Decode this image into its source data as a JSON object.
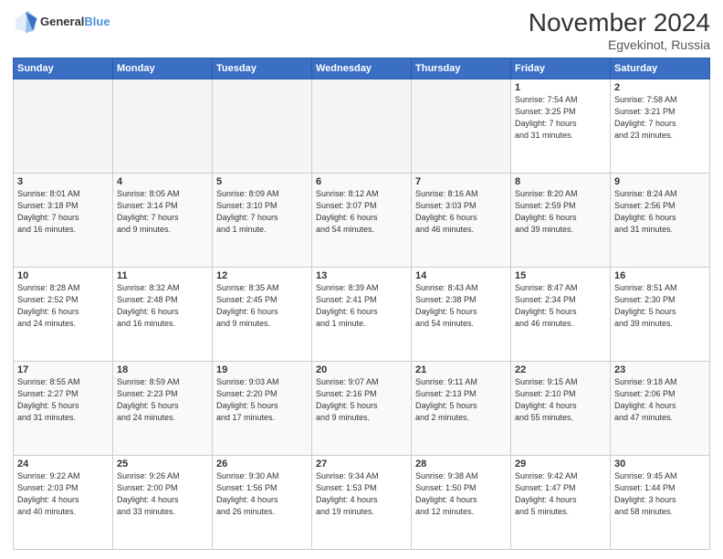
{
  "header": {
    "logo_line1": "General",
    "logo_line2": "Blue",
    "title": "November 2024",
    "subtitle": "Egvekinot, Russia"
  },
  "days_of_week": [
    "Sunday",
    "Monday",
    "Tuesday",
    "Wednesday",
    "Thursday",
    "Friday",
    "Saturday"
  ],
  "weeks": [
    [
      {
        "day": "",
        "info": ""
      },
      {
        "day": "",
        "info": ""
      },
      {
        "day": "",
        "info": ""
      },
      {
        "day": "",
        "info": ""
      },
      {
        "day": "",
        "info": ""
      },
      {
        "day": "1",
        "info": "Sunrise: 7:54 AM\nSunset: 3:25 PM\nDaylight: 7 hours\nand 31 minutes."
      },
      {
        "day": "2",
        "info": "Sunrise: 7:58 AM\nSunset: 3:21 PM\nDaylight: 7 hours\nand 23 minutes."
      }
    ],
    [
      {
        "day": "3",
        "info": "Sunrise: 8:01 AM\nSunset: 3:18 PM\nDaylight: 7 hours\nand 16 minutes."
      },
      {
        "day": "4",
        "info": "Sunrise: 8:05 AM\nSunset: 3:14 PM\nDaylight: 7 hours\nand 9 minutes."
      },
      {
        "day": "5",
        "info": "Sunrise: 8:09 AM\nSunset: 3:10 PM\nDaylight: 7 hours\nand 1 minute."
      },
      {
        "day": "6",
        "info": "Sunrise: 8:12 AM\nSunset: 3:07 PM\nDaylight: 6 hours\nand 54 minutes."
      },
      {
        "day": "7",
        "info": "Sunrise: 8:16 AM\nSunset: 3:03 PM\nDaylight: 6 hours\nand 46 minutes."
      },
      {
        "day": "8",
        "info": "Sunrise: 8:20 AM\nSunset: 2:59 PM\nDaylight: 6 hours\nand 39 minutes."
      },
      {
        "day": "9",
        "info": "Sunrise: 8:24 AM\nSunset: 2:56 PM\nDaylight: 6 hours\nand 31 minutes."
      }
    ],
    [
      {
        "day": "10",
        "info": "Sunrise: 8:28 AM\nSunset: 2:52 PM\nDaylight: 6 hours\nand 24 minutes."
      },
      {
        "day": "11",
        "info": "Sunrise: 8:32 AM\nSunset: 2:48 PM\nDaylight: 6 hours\nand 16 minutes."
      },
      {
        "day": "12",
        "info": "Sunrise: 8:35 AM\nSunset: 2:45 PM\nDaylight: 6 hours\nand 9 minutes."
      },
      {
        "day": "13",
        "info": "Sunrise: 8:39 AM\nSunset: 2:41 PM\nDaylight: 6 hours\nand 1 minute."
      },
      {
        "day": "14",
        "info": "Sunrise: 8:43 AM\nSunset: 2:38 PM\nDaylight: 5 hours\nand 54 minutes."
      },
      {
        "day": "15",
        "info": "Sunrise: 8:47 AM\nSunset: 2:34 PM\nDaylight: 5 hours\nand 46 minutes."
      },
      {
        "day": "16",
        "info": "Sunrise: 8:51 AM\nSunset: 2:30 PM\nDaylight: 5 hours\nand 39 minutes."
      }
    ],
    [
      {
        "day": "17",
        "info": "Sunrise: 8:55 AM\nSunset: 2:27 PM\nDaylight: 5 hours\nand 31 minutes."
      },
      {
        "day": "18",
        "info": "Sunrise: 8:59 AM\nSunset: 2:23 PM\nDaylight: 5 hours\nand 24 minutes."
      },
      {
        "day": "19",
        "info": "Sunrise: 9:03 AM\nSunset: 2:20 PM\nDaylight: 5 hours\nand 17 minutes."
      },
      {
        "day": "20",
        "info": "Sunrise: 9:07 AM\nSunset: 2:16 PM\nDaylight: 5 hours\nand 9 minutes."
      },
      {
        "day": "21",
        "info": "Sunrise: 9:11 AM\nSunset: 2:13 PM\nDaylight: 5 hours\nand 2 minutes."
      },
      {
        "day": "22",
        "info": "Sunrise: 9:15 AM\nSunset: 2:10 PM\nDaylight: 4 hours\nand 55 minutes."
      },
      {
        "day": "23",
        "info": "Sunrise: 9:18 AM\nSunset: 2:06 PM\nDaylight: 4 hours\nand 47 minutes."
      }
    ],
    [
      {
        "day": "24",
        "info": "Sunrise: 9:22 AM\nSunset: 2:03 PM\nDaylight: 4 hours\nand 40 minutes."
      },
      {
        "day": "25",
        "info": "Sunrise: 9:26 AM\nSunset: 2:00 PM\nDaylight: 4 hours\nand 33 minutes."
      },
      {
        "day": "26",
        "info": "Sunrise: 9:30 AM\nSunset: 1:56 PM\nDaylight: 4 hours\nand 26 minutes."
      },
      {
        "day": "27",
        "info": "Sunrise: 9:34 AM\nSunset: 1:53 PM\nDaylight: 4 hours\nand 19 minutes."
      },
      {
        "day": "28",
        "info": "Sunrise: 9:38 AM\nSunset: 1:50 PM\nDaylight: 4 hours\nand 12 minutes."
      },
      {
        "day": "29",
        "info": "Sunrise: 9:42 AM\nSunset: 1:47 PM\nDaylight: 4 hours\nand 5 minutes."
      },
      {
        "day": "30",
        "info": "Sunrise: 9:45 AM\nSunset: 1:44 PM\nDaylight: 3 hours\nand 58 minutes."
      }
    ]
  ]
}
